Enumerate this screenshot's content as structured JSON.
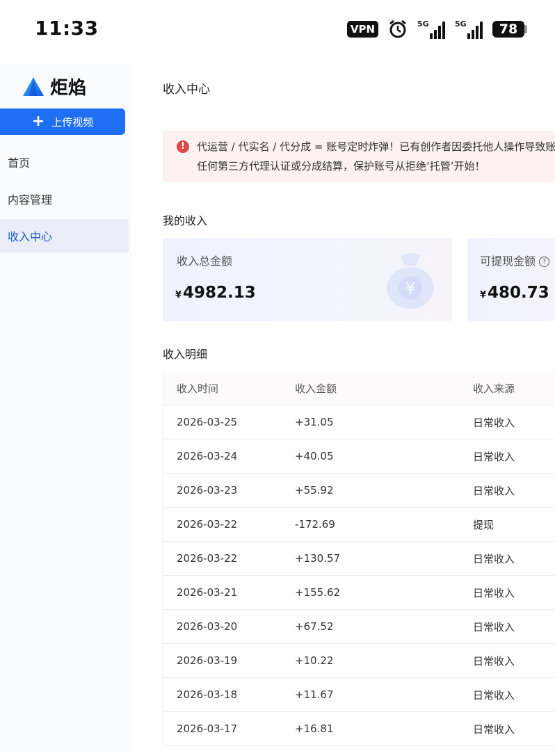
{
  "status_bar": {
    "time": "11:33",
    "vpn": "VPN",
    "signal1": "5G",
    "signal2": "5G",
    "battery": "78"
  },
  "sidebar": {
    "logo_text": "炬焰",
    "upload_label": "上传视频",
    "items": [
      {
        "label": "首页",
        "active": false
      },
      {
        "label": "内容管理",
        "active": false
      },
      {
        "label": "收入中心",
        "active": true
      }
    ]
  },
  "main": {
    "title": "收入中心",
    "alert": {
      "line1": "代运营 / 代实名 / 代分成 = 账号定时炸弹！已有创作者因委托他人操作导致账",
      "line2": "任何第三方代理认证或分成结算，保护账号从拒绝‘托管’开始！"
    },
    "my_income_title": "我的收入",
    "total_card": {
      "label": "收入总金额",
      "currency": "¥",
      "amount": "4982.13"
    },
    "available_card": {
      "label": "可提现金额",
      "currency": "¥",
      "amount": "480.73"
    },
    "detail_title": "收入明细",
    "table": {
      "headers": [
        "收入时间",
        "收入金额",
        "收入来源"
      ],
      "rows": [
        [
          "2026-03-25",
          "+31.05",
          "日常收入"
        ],
        [
          "2026-03-24",
          "+40.05",
          "日常收入"
        ],
        [
          "2026-03-23",
          "+55.92",
          "日常收入"
        ],
        [
          "2026-03-22",
          "-172.69",
          "提现"
        ],
        [
          "2026-03-22",
          "+130.57",
          "日常收入"
        ],
        [
          "2026-03-21",
          "+155.62",
          "日常收入"
        ],
        [
          "2026-03-20",
          "+67.52",
          "日常收入"
        ],
        [
          "2026-03-19",
          "+10.22",
          "日常收入"
        ],
        [
          "2026-03-18",
          "+11.67",
          "日常收入"
        ],
        [
          "2026-03-17",
          "+16.81",
          "日常收入"
        ]
      ]
    }
  },
  "colors": {
    "primary": "#1f6ff2",
    "active_nav_bg": "#e9edf8",
    "alert_bg": "#fdf1f1",
    "alert_icon": "#e04848"
  }
}
